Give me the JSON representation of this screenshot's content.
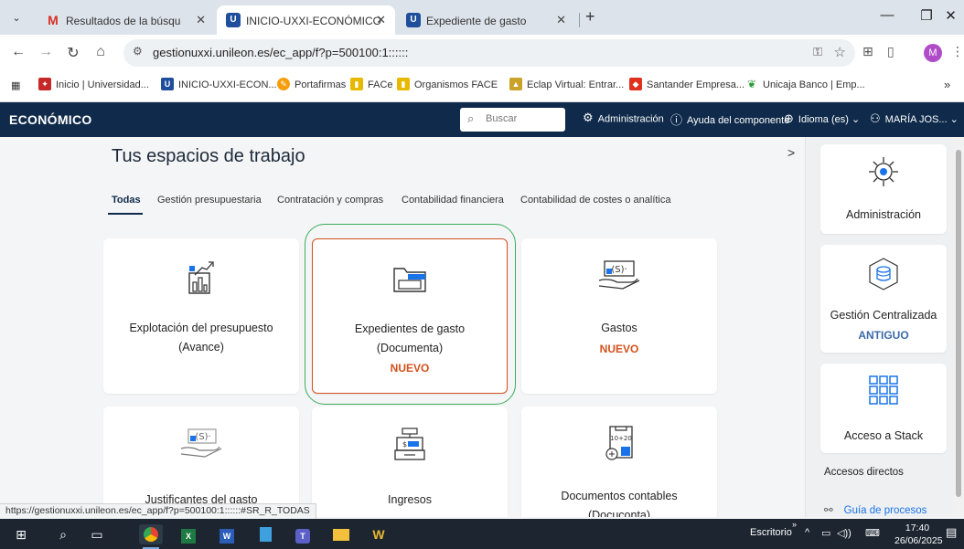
{
  "browser": {
    "tabs": [
      {
        "label": "Resultados de la búsqueda - m",
        "favicon": "gmail-icon"
      },
      {
        "label": "INICIO-UXXI-ECONÓMICO",
        "favicon": "uxxi-icon",
        "active": true
      },
      {
        "label": "Expediente de gasto",
        "favicon": "uxxi-icon"
      }
    ],
    "url": "gestionuxxi.unileon.es/ec_app/f?p=500100:1::::::",
    "bookmarks": [
      "Inicio | Universidad...",
      "INICIO-UXXI-ECON...",
      "Portafirmas",
      "FACe",
      "Organismos FACE",
      "Eclap Virtual: Entrar...",
      "Santander Empresa...",
      "Unicaja Banco | Emp..."
    ],
    "profile_initial": "M",
    "status_url": "https://gestionuxxi.unileon.es/ec_app/f?p=500100:1::::::#SR_R_TODAS"
  },
  "header": {
    "brand": "ECONÓMICO",
    "search_placeholder": "Buscar",
    "admin": "Administración",
    "help": "Ayuda del componente",
    "language": "Idioma (es)",
    "user": "MARÍA JOS..."
  },
  "main": {
    "title": "Tus espacios de trabajo",
    "tabs": [
      {
        "label": "Todas",
        "active": true
      },
      {
        "label": "Gestión presupuestaria"
      },
      {
        "label": "Contratación y compras"
      },
      {
        "label": "Contabilidad financiera"
      },
      {
        "label": "Contabilidad de costes o analítica"
      }
    ],
    "cards": [
      {
        "title1": "Explotación del presupuesto",
        "title2": "(Avance)",
        "badge": "",
        "icon": "budget-chart-icon"
      },
      {
        "title1": "Expedientes de gasto",
        "title2": "(Documenta)",
        "badge": "NUEVO",
        "icon": "folder-icon"
      },
      {
        "title1": "Gastos",
        "title2": "",
        "badge": "NUEVO",
        "icon": "money-hand-icon"
      },
      {
        "title1": "Justificantes del gasto",
        "title2": "",
        "badge": "",
        "icon": "receipt-hand-icon"
      },
      {
        "title1": "Ingresos",
        "title2": "",
        "badge": "",
        "icon": "cash-register-icon"
      },
      {
        "title1": "Documentos contables",
        "title2": "(Docuconta)",
        "badge": "",
        "icon": "accounting-docs-icon"
      }
    ]
  },
  "sidebar": {
    "cards": [
      {
        "title": "Administración",
        "sub": "",
        "icon": "gear-cog-icon"
      },
      {
        "title": "Gestión Centralizada",
        "sub": "ANTIGUO",
        "icon": "database-network-icon"
      },
      {
        "title": "Acceso a Stack",
        "sub": "",
        "icon": "grid-apps-icon"
      }
    ],
    "quick_title": "Accesos directos",
    "quick_links": [
      "Guía de procesos"
    ]
  },
  "taskbar": {
    "desktop_label": "Escritorio",
    "time": "17:40",
    "date": "26/06/2025"
  },
  "colors": {
    "header_bg": "#0f2a4a",
    "accent_new": "#d4501c",
    "highlight_halo": "#3dad5b",
    "sub_blue": "#3b6aa8"
  }
}
